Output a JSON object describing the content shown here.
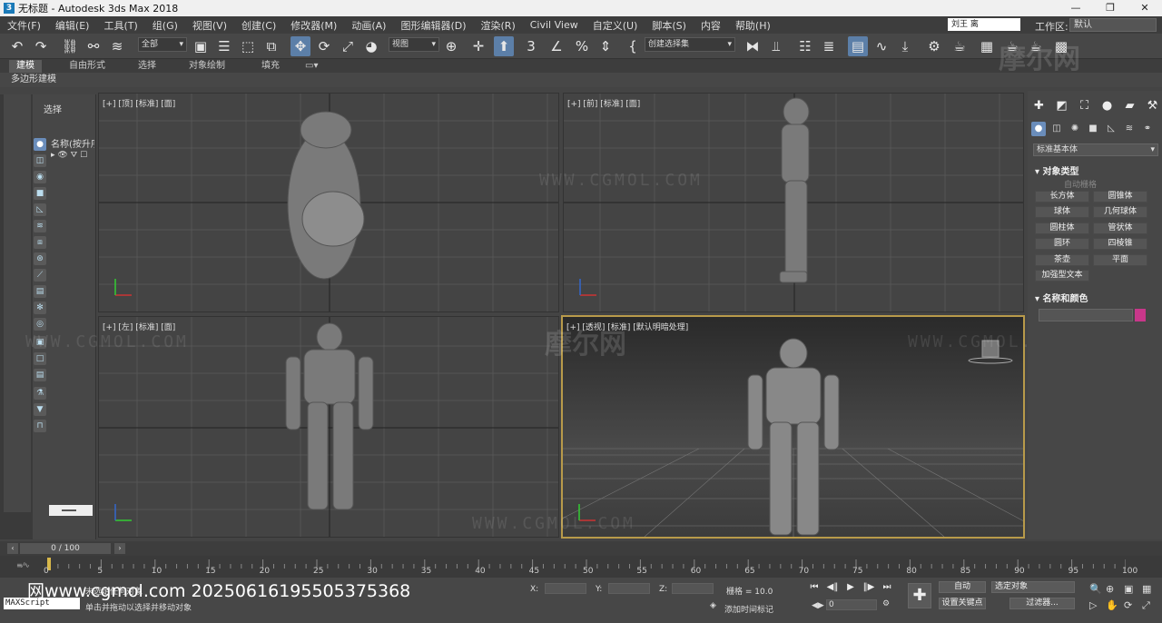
{
  "window": {
    "title": "无标题 - Autodesk 3ds Max 2018",
    "controls": [
      "—",
      "❐",
      "✕"
    ]
  },
  "menu": {
    "items": [
      "文件(F)",
      "编辑(E)",
      "工具(T)",
      "组(G)",
      "视图(V)",
      "创建(C)",
      "修改器(M)",
      "动画(A)",
      "图形编辑器(D)",
      "渲染(R)",
      "Civil View",
      "自定义(U)",
      "脚本(S)",
      "内容",
      "帮助(H)"
    ],
    "user": "刘王 离",
    "workspace_label": "工作区:",
    "workspace_value": "默认"
  },
  "toolbar": {
    "selection_filter": "全部",
    "ref_coord": "视图",
    "named_selection": "创建选择集"
  },
  "ribbon": {
    "tabs": [
      "建模",
      "自由形式",
      "选择",
      "对象绘制",
      "填充"
    ],
    "active_tab": "建模",
    "sub_label": "多边形建模"
  },
  "explorer": {
    "select_label": "选择",
    "column_header": "名称(按升序",
    "row_text": "▸ 👁 ⛛ ☐"
  },
  "viewports": {
    "top": {
      "label": "[+] [顶] [标准] [面]"
    },
    "front": {
      "label": "[+] [前] [标准] [面]"
    },
    "left": {
      "label": "[+] [左] [标准] [面]"
    },
    "perspective": {
      "label": "[+] [透视] [标准] [默认明暗处理]"
    }
  },
  "watermarks": {
    "text": "WWW.CGMOL.COM",
    "logo": "摩尔网"
  },
  "command_panel": {
    "category": "标准基本体",
    "rollout_object_type": "对象类型",
    "autogrid": "自动栅格",
    "object_buttons": [
      "长方体",
      "圆锥体",
      "球体",
      "几何球体",
      "圆柱体",
      "管状体",
      "圆环",
      "四棱锥",
      "茶壶",
      "平面",
      "加强型文本"
    ],
    "rollout_name_color": "名称和颜色",
    "swatch_color": "#c8378a"
  },
  "timeline": {
    "frame_display": "0 / 100",
    "ticks": [
      "0",
      "5",
      "10",
      "15",
      "20",
      "25",
      "30",
      "35",
      "40",
      "45",
      "50",
      "55",
      "60",
      "65",
      "70",
      "75",
      "80",
      "85",
      "90",
      "95",
      "100"
    ]
  },
  "status": {
    "maxscript": "MAXScript",
    "selection_status": "未选定任何对象",
    "prompt": "单击并拖动以选择并移动对象",
    "x_label": "X:",
    "y_label": "Y:",
    "z_label": "Z:",
    "grid_label": "栅格 = 10.0",
    "add_time_tag": "添加时间标记",
    "auto_key": "自动",
    "set_key": "设置关键点",
    "selected_objects": "选定对象",
    "filters": "过滤器...",
    "current_frame": "0",
    "url_overlay": "网www.cgmol.com 20250616195505375368"
  }
}
